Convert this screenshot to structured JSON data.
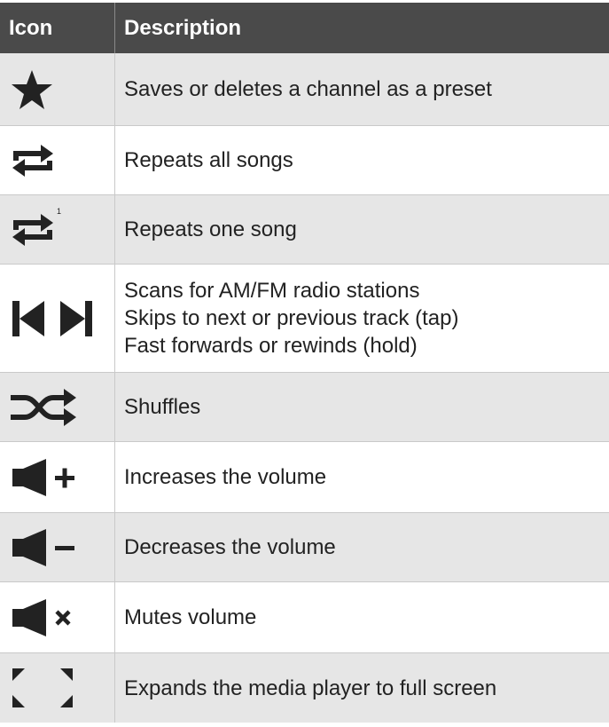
{
  "table": {
    "headers": {
      "icon": "Icon",
      "description": "Description"
    },
    "rows": [
      {
        "icon": "star-icon",
        "lines": [
          "Saves or deletes a channel as a preset"
        ]
      },
      {
        "icon": "repeat-all-icon",
        "lines": [
          "Repeats all songs"
        ]
      },
      {
        "icon": "repeat-one-icon",
        "badge": "1",
        "lines": [
          "Repeats one song"
        ]
      },
      {
        "icon": "skip-previous-next-icon",
        "lines": [
          "Scans for AM/FM radio stations",
          "Skips to next or previous track (tap)",
          "Fast forwards or rewinds (hold)"
        ]
      },
      {
        "icon": "shuffle-icon",
        "lines": [
          "Shuffles"
        ]
      },
      {
        "icon": "volume-up-icon",
        "lines": [
          "Increases the volume"
        ]
      },
      {
        "icon": "volume-down-icon",
        "lines": [
          "Decreases the volume"
        ]
      },
      {
        "icon": "mute-icon",
        "lines": [
          "Mutes volume"
        ]
      },
      {
        "icon": "fullscreen-icon",
        "lines": [
          "Expands the media player to full screen"
        ]
      }
    ]
  },
  "colors": {
    "header_bg": "#4a4a4a",
    "shaded_row": "#e6e6e6",
    "icon_color": "#222222"
  }
}
